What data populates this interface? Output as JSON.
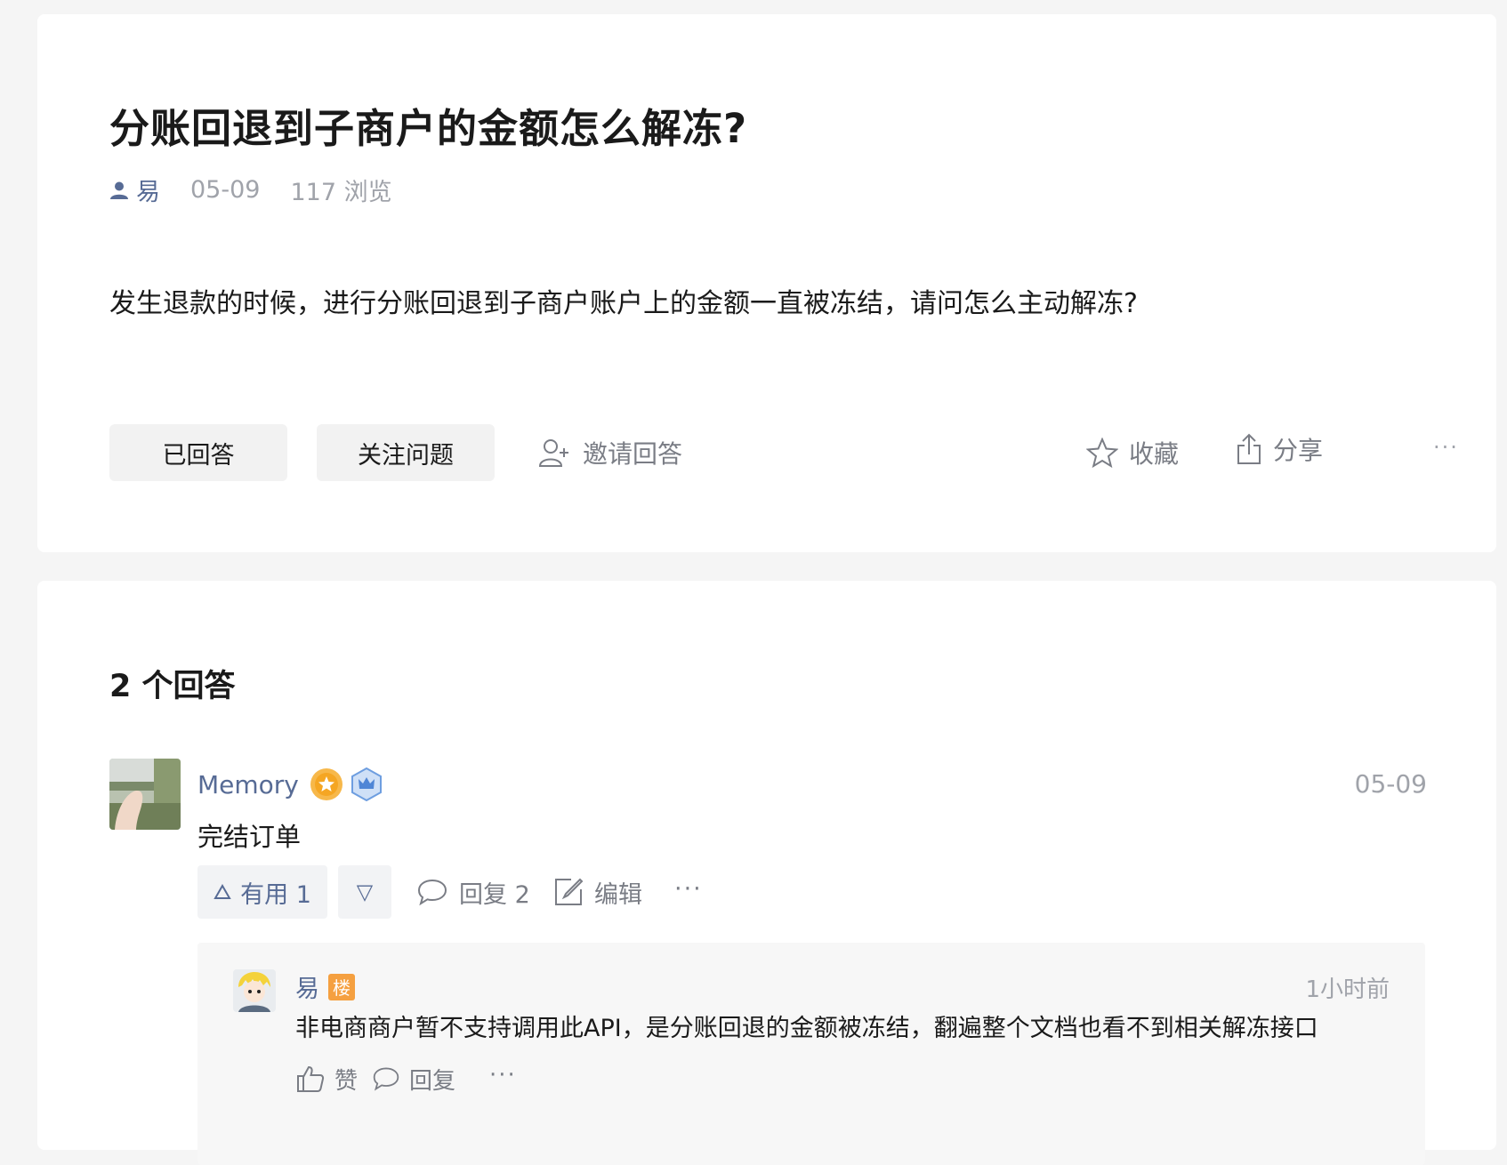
{
  "question": {
    "title": "分账回退到子商户的金额怎么解冻?",
    "author": "易",
    "date": "05-09",
    "views": "117 浏览",
    "body": "发生退款的时候，进行分账回退到子商户账户上的金额一直被冻结，请问怎么主动解冻?",
    "actions": {
      "answered": "已回答",
      "follow": "关注问题",
      "invite": "邀请回答",
      "favorite": "收藏",
      "share": "分享",
      "more": "···"
    }
  },
  "answers": {
    "count_title": "2 个回答",
    "items": [
      {
        "author": "Memory",
        "date": "05-09",
        "text": "完结订单",
        "useful": "有用 1",
        "down": "▽",
        "reply": "回复 2",
        "edit": "编辑",
        "more": "···",
        "replies": [
          {
            "author": "易",
            "badge": "楼",
            "time": "1小时前",
            "text": "非电商商户暂不支持调用此API，是分账回退的金额被冻结，翻遍整个文档也看不到相关解冻接口",
            "like": "赞",
            "reply": "回复",
            "more": "···"
          }
        ]
      }
    ]
  },
  "colors": {
    "link": "#576b95",
    "muted": "#a0a3aa",
    "badge": "#f5a040",
    "background": "#f5f5f5"
  }
}
